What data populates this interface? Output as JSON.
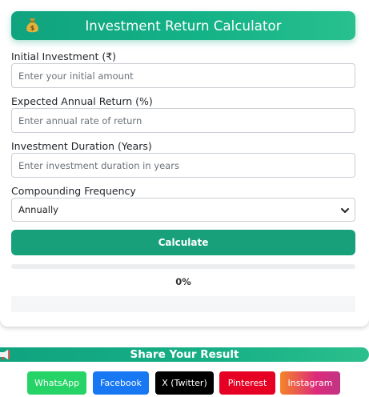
{
  "header": {
    "title": "Investment Return Calculator",
    "icon": "money-bag-icon",
    "gradient_start": "#10a37f",
    "gradient_end": "#28c08e"
  },
  "form": {
    "initial_investment": {
      "label": "Initial Investment (₹)",
      "placeholder": "Enter your initial amount",
      "value": ""
    },
    "annual_return": {
      "label": "Expected Annual Return (%)",
      "placeholder": "Enter annual rate of return",
      "value": ""
    },
    "duration": {
      "label": "Investment Duration (Years)",
      "placeholder": "Enter investment duration in years",
      "value": ""
    },
    "compounding": {
      "label": "Compounding Frequency",
      "selected": "Annually"
    }
  },
  "calculate_button": {
    "label": "Calculate",
    "color": "#17a07a"
  },
  "progress": {
    "percent": 0,
    "label": "0%"
  },
  "share": {
    "title": "Share Your Result",
    "icon": "megaphone-icon",
    "buttons": [
      {
        "label": "WhatsApp",
        "color": "#25d366"
      },
      {
        "label": "Facebook",
        "color": "#1877f2"
      },
      {
        "label": "X (Twitter)",
        "color": "#000000"
      },
      {
        "label": "Pinterest",
        "color": "#e60023"
      },
      {
        "label": "Instagram",
        "color": "#e1306c"
      }
    ]
  }
}
